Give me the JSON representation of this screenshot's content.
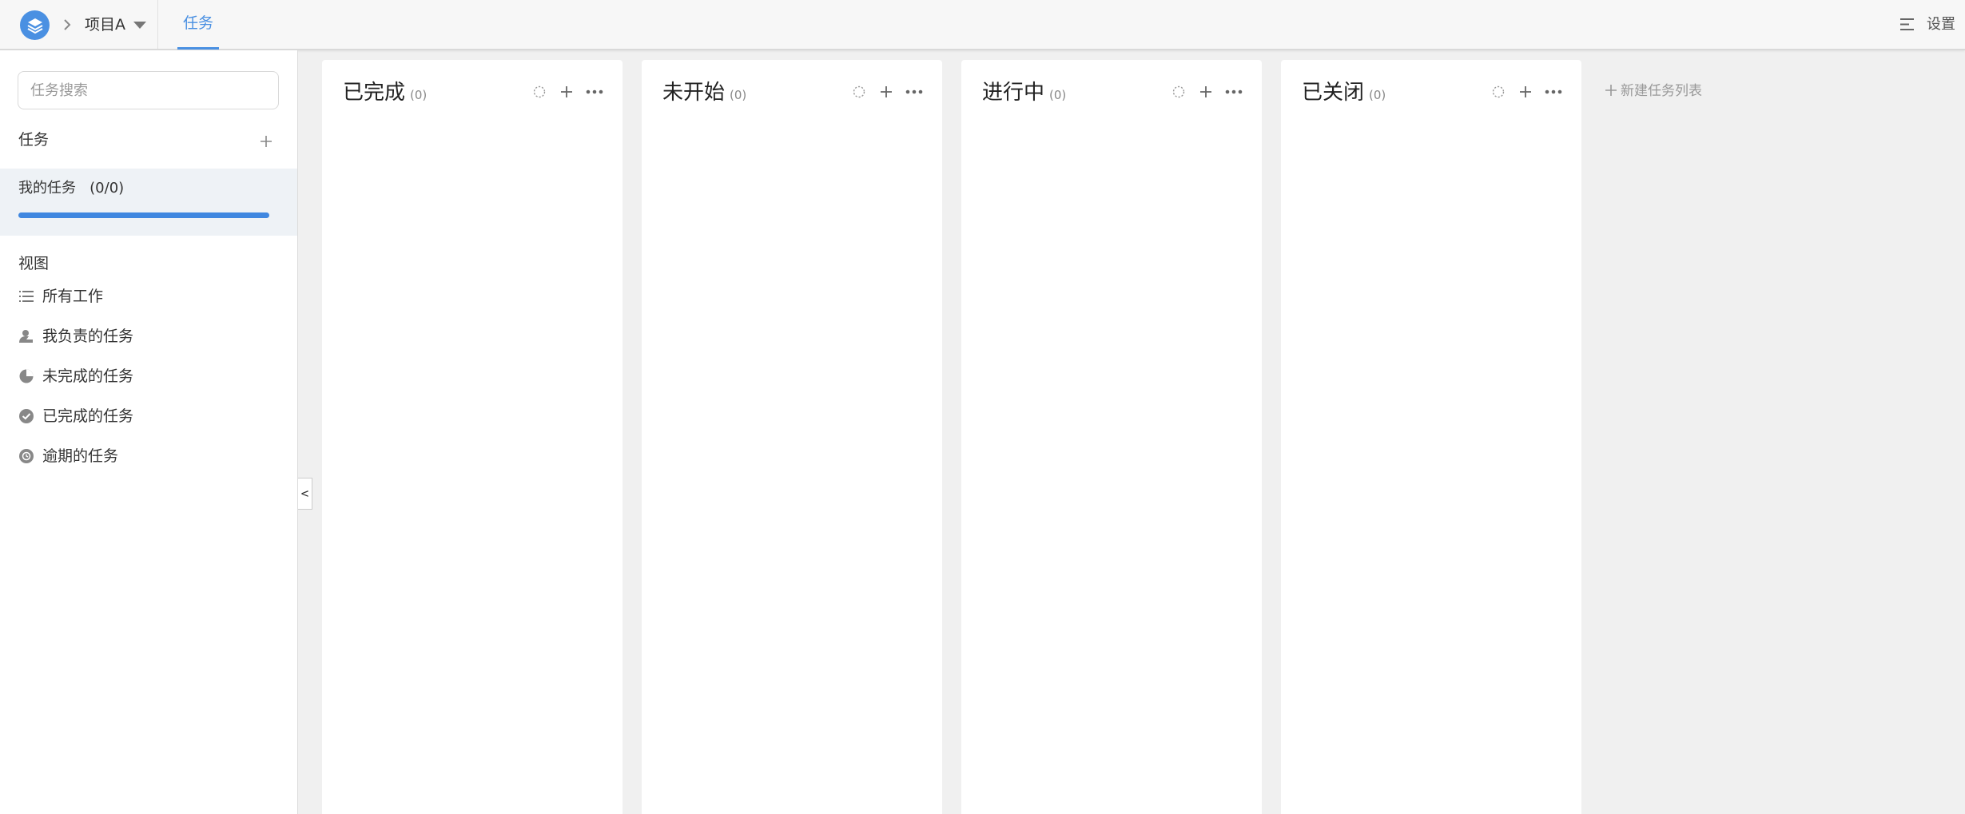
{
  "header": {
    "project_name": "项目A",
    "active_tab": "任务",
    "settings_label": "设置",
    "accent_color": "#4a90e2"
  },
  "sidebar": {
    "search_placeholder": "任务搜索",
    "task_section_label": "任务",
    "my_tasks": {
      "label": "我的任务   (0/0)",
      "progress": 1.0
    },
    "view_section_label": "视图",
    "views": [
      {
        "label": "所有工作",
        "icon": "list-icon"
      },
      {
        "label": "我负责的任务",
        "icon": "user-assign-icon"
      },
      {
        "label": "未完成的任务",
        "icon": "half-circle-icon"
      },
      {
        "label": "已完成的任务",
        "icon": "check-circle-icon"
      },
      {
        "label": "逾期的任务",
        "icon": "overdue-icon"
      }
    ],
    "collapse_label": "<"
  },
  "board": {
    "columns": [
      {
        "title": "已完成",
        "count": "(0)"
      },
      {
        "title": "未开始",
        "count": "(0)"
      },
      {
        "title": "进行中",
        "count": "(0)"
      },
      {
        "title": "已关闭",
        "count": "(0)"
      }
    ],
    "new_list_label": "新建任务列表"
  }
}
